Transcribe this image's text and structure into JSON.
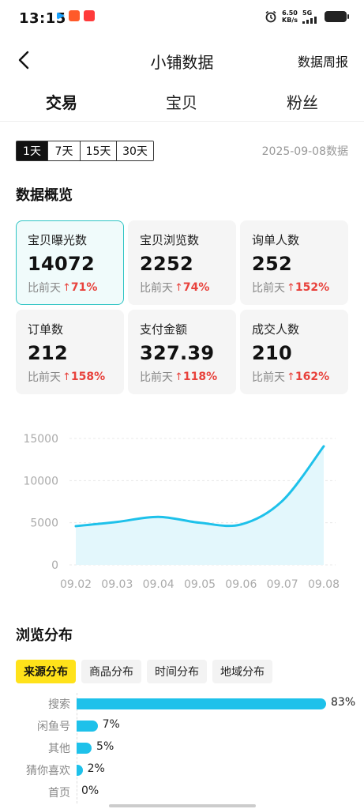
{
  "status_bar": {
    "time": "13:15",
    "net_speed_value": "6.50",
    "net_speed_unit": "KB/s",
    "network": "5G"
  },
  "nav": {
    "title": "小铺数据",
    "right_link": "数据周报"
  },
  "tabs": [
    {
      "label": "交易",
      "active": true
    },
    {
      "label": "宝贝",
      "active": false
    },
    {
      "label": "粉丝",
      "active": false
    }
  ],
  "ranges": [
    {
      "label": "1天",
      "active": true
    },
    {
      "label": "7天",
      "active": false
    },
    {
      "label": "15天",
      "active": false
    },
    {
      "label": "30天",
      "active": false
    }
  ],
  "data_date": "2025-09-08数据",
  "overview": {
    "title": "数据概览",
    "compare_label": "比前天",
    "cards": [
      {
        "label": "宝贝曝光数",
        "value": "14072",
        "change": "71%",
        "active": true
      },
      {
        "label": "宝贝浏览数",
        "value": "2252",
        "change": "74%",
        "active": false
      },
      {
        "label": "询单人数",
        "value": "252",
        "change": "152%",
        "active": false
      },
      {
        "label": "订单数",
        "value": "212",
        "change": "158%",
        "active": false
      },
      {
        "label": "支付金额",
        "value": "327.39",
        "change": "118%",
        "active": false
      },
      {
        "label": "成交人数",
        "value": "210",
        "change": "162%",
        "active": false
      }
    ]
  },
  "chart_data": {
    "type": "area",
    "x": [
      "09.02",
      "09.03",
      "09.04",
      "09.05",
      "09.06",
      "09.07",
      "09.08"
    ],
    "series": [
      {
        "values": [
          4600,
          5100,
          5700,
          5000,
          4800,
          7600,
          14072
        ]
      }
    ],
    "yticks": [
      0,
      5000,
      10000,
      15000
    ],
    "ylim": [
      0,
      15000
    ],
    "grid": true,
    "colors": {
      "line": "#1ec1ea",
      "fill": "#e3f7fc"
    }
  },
  "distribution": {
    "title": "浏览分布",
    "tabs": [
      {
        "label": "来源分布",
        "active": true
      },
      {
        "label": "商品分布",
        "active": false
      },
      {
        "label": "时间分布",
        "active": false
      },
      {
        "label": "地域分布",
        "active": false
      }
    ],
    "items": [
      {
        "label": "搜索",
        "percent": 83,
        "value": "83%"
      },
      {
        "label": "闲鱼号",
        "percent": 7,
        "value": "7%"
      },
      {
        "label": "其他",
        "percent": 5,
        "value": "5%"
      },
      {
        "label": "猜你喜欢",
        "percent": 2,
        "value": "2%"
      },
      {
        "label": "首页",
        "percent": 0,
        "value": "0%"
      }
    ],
    "bar_color": "#1ec1ea"
  }
}
